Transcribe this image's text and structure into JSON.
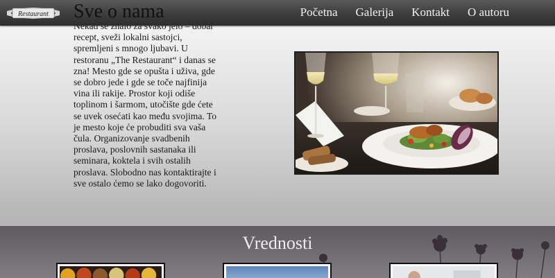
{
  "header": {
    "logo_text": "Restaurant",
    "page_title": "Sve o nama",
    "nav": [
      {
        "label": "Početna"
      },
      {
        "label": "Galerija"
      },
      {
        "label": "Kontakt"
      },
      {
        "label": "O autoru"
      }
    ]
  },
  "about": {
    "text": "Nekad se znalo za svako jelo – dobar recept, sveži lokalni sastojci, spremljeni s mnogo ljubavi. U restoranu „The Restaurant“ i danas se zna! Mesto gde se opušta i uživa, gde se dobro jede i gde se toče najfinija vina ili rakije. Prostor koji odiše toplinom i šarmom, utočište gde ćete se uvek osećati kao među svojima. To je mesto koje će probuditi sva vaša čula. Organizovanje svadbenih proslava, poslovnih sastanaka ili seminara, koktela i svih ostalih proslava. Slobodno nas kontaktirajte i sve ostalo ćemo se lako dogovoriti."
  },
  "values": {
    "title": "Vrednosti"
  },
  "colors": {
    "header_bg": "#3d3d3d",
    "nav_text": "#f2f2f2",
    "values_bg": "#6a666b"
  }
}
